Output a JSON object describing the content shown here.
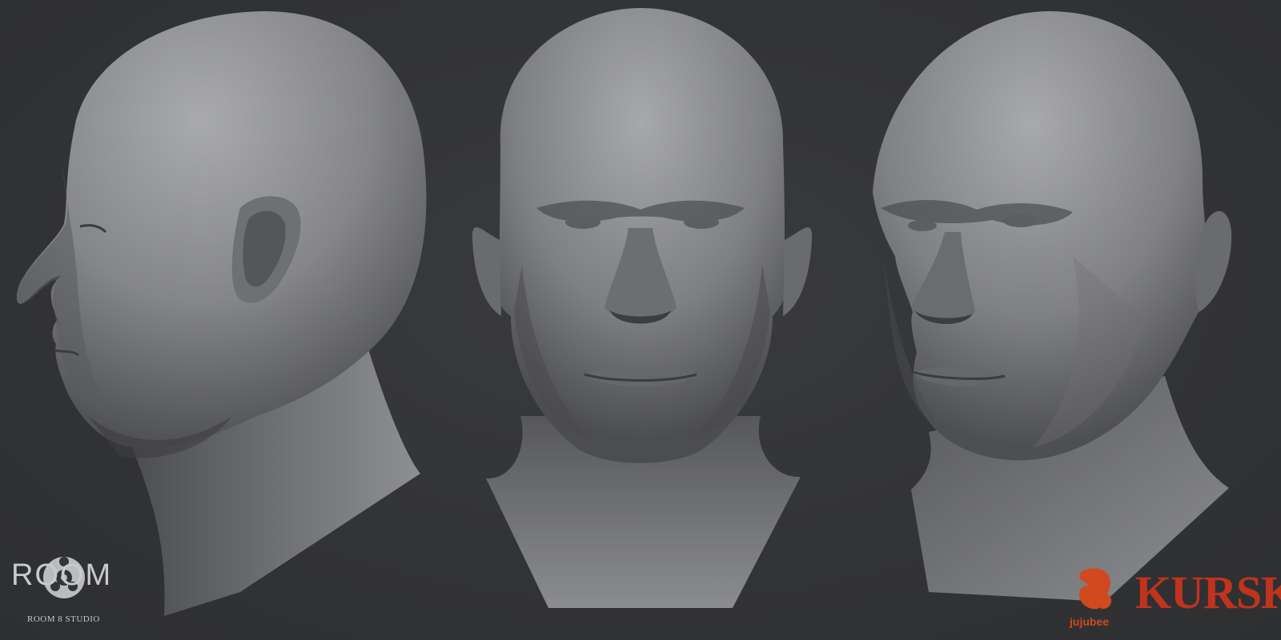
{
  "image": {
    "subject": "",
    "views": [
      {
        "id": "side",
        "name": "left-profile"
      },
      {
        "id": "front",
        "name": "front"
      },
      {
        "id": "three-quarter",
        "name": "three-quarter"
      }
    ]
  },
  "logos": {
    "studio": {
      "word": "ROOM",
      "number": "8",
      "subtitle": "ROOM 8 STUDIO"
    },
    "publisher": {
      "word": "jujubee",
      "trademark": "®",
      "color": "#d1491f"
    },
    "game": {
      "word": "KURSK",
      "color": "#c0331d"
    }
  },
  "colors": {
    "background": "#333436",
    "skin_light": "#a8a9ab",
    "skin_mid": "#77787a",
    "skin_dark": "#3c3d3f"
  }
}
